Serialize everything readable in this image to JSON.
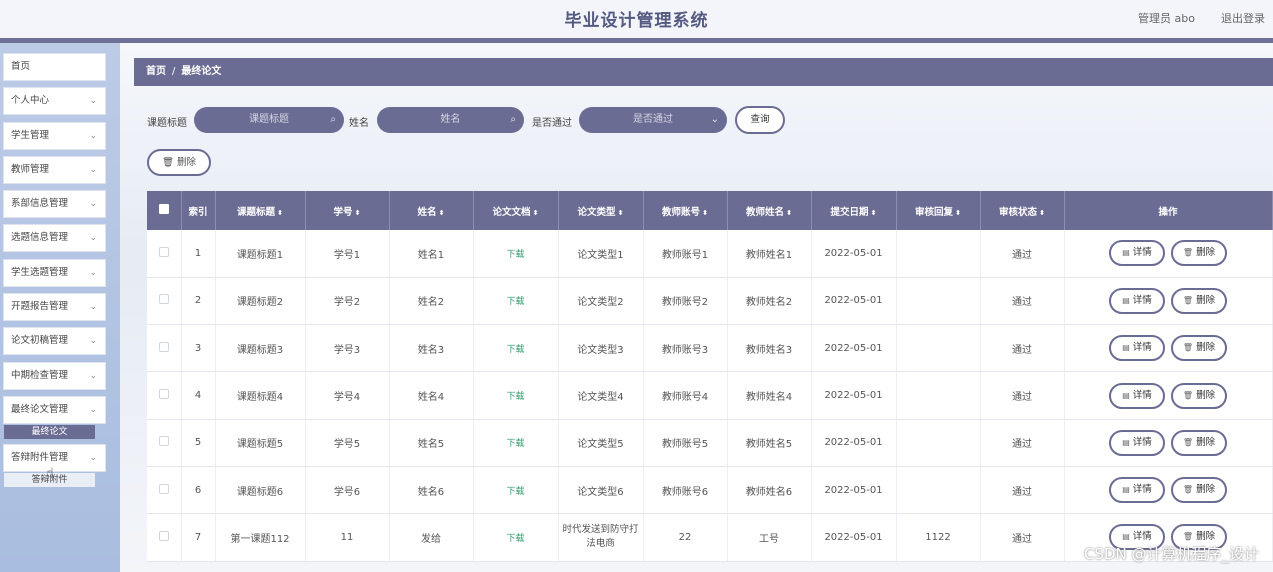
{
  "header": {
    "title": "毕业设计管理系统",
    "user": "管理员 abo",
    "logout": "退出登录"
  },
  "sidebar": {
    "items": [
      {
        "label": "首页",
        "chevron": false
      },
      {
        "label": "个人中心",
        "chevron": true
      },
      {
        "label": "学生管理",
        "chevron": true
      },
      {
        "label": "教师管理",
        "chevron": true
      },
      {
        "label": "系部信息管理",
        "chevron": true
      },
      {
        "label": "选题信息管理",
        "chevron": true
      },
      {
        "label": "学生选题管理",
        "chevron": true
      },
      {
        "label": "开题报告管理",
        "chevron": true
      },
      {
        "label": "论文初稿管理",
        "chevron": true
      },
      {
        "label": "中期检查管理",
        "chevron": true
      },
      {
        "label": "最终论文管理",
        "chevron": true
      },
      {
        "label": "答辩附件管理",
        "chevron": true
      }
    ],
    "sub_active": "最终论文",
    "sub_hover": "答辩附件"
  },
  "breadcrumb": {
    "home": "首页",
    "sep": "/",
    "current": "最终论文"
  },
  "filters": {
    "title_label": "课题标题",
    "title_placeholder": "课题标题",
    "name_label": "姓名",
    "name_placeholder": "姓名",
    "pass_label": "是否通过",
    "pass_placeholder": "是否通过",
    "query": "查询"
  },
  "actions": {
    "bulk_delete": "删除"
  },
  "table": {
    "headers": [
      "索引",
      "课题标题",
      "学号",
      "姓名",
      "论文文档",
      "论文类型",
      "教师账号",
      "教师姓名",
      "提交日期",
      "审核回复",
      "审核状态",
      "操作"
    ],
    "detail_label": "详情",
    "delete_label": "删除",
    "rows": [
      {
        "idx": "1",
        "title": "课题标题1",
        "sno": "学号1",
        "name": "姓名1",
        "doc": "下载",
        "type": "论文类型1",
        "tacc": "教师账号1",
        "tname": "教师姓名1",
        "date": "2022-05-01",
        "reply": "",
        "status": "通过"
      },
      {
        "idx": "2",
        "title": "课题标题2",
        "sno": "学号2",
        "name": "姓名2",
        "doc": "下载",
        "type": "论文类型2",
        "tacc": "教师账号2",
        "tname": "教师姓名2",
        "date": "2022-05-01",
        "reply": "",
        "status": "通过"
      },
      {
        "idx": "3",
        "title": "课题标题3",
        "sno": "学号3",
        "name": "姓名3",
        "doc": "下载",
        "type": "论文类型3",
        "tacc": "教师账号3",
        "tname": "教师姓名3",
        "date": "2022-05-01",
        "reply": "",
        "status": "通过"
      },
      {
        "idx": "4",
        "title": "课题标题4",
        "sno": "学号4",
        "name": "姓名4",
        "doc": "下载",
        "type": "论文类型4",
        "tacc": "教师账号4",
        "tname": "教师姓名4",
        "date": "2022-05-01",
        "reply": "",
        "status": "通过"
      },
      {
        "idx": "5",
        "title": "课题标题5",
        "sno": "学号5",
        "name": "姓名5",
        "doc": "下载",
        "type": "论文类型5",
        "tacc": "教师账号5",
        "tname": "教师姓名5",
        "date": "2022-05-01",
        "reply": "",
        "status": "通过"
      },
      {
        "idx": "6",
        "title": "课题标题6",
        "sno": "学号6",
        "name": "姓名6",
        "doc": "下载",
        "type": "论文类型6",
        "tacc": "教师账号6",
        "tname": "教师姓名6",
        "date": "2022-05-01",
        "reply": "",
        "status": "通过"
      },
      {
        "idx": "7",
        "title": "第一课题112",
        "sno": "11",
        "name": "发给",
        "doc": "下载",
        "type": "时代发送到防守打法电商",
        "tacc": "22",
        "tname": "工号",
        "date": "2022-05-01",
        "reply": "1122",
        "status": "通过"
      }
    ]
  },
  "watermark": "CSDN @计算机程序_设计",
  "colors": {
    "primary": "#6b6c93",
    "download": "#2f9a6a",
    "title": "#545a80"
  }
}
